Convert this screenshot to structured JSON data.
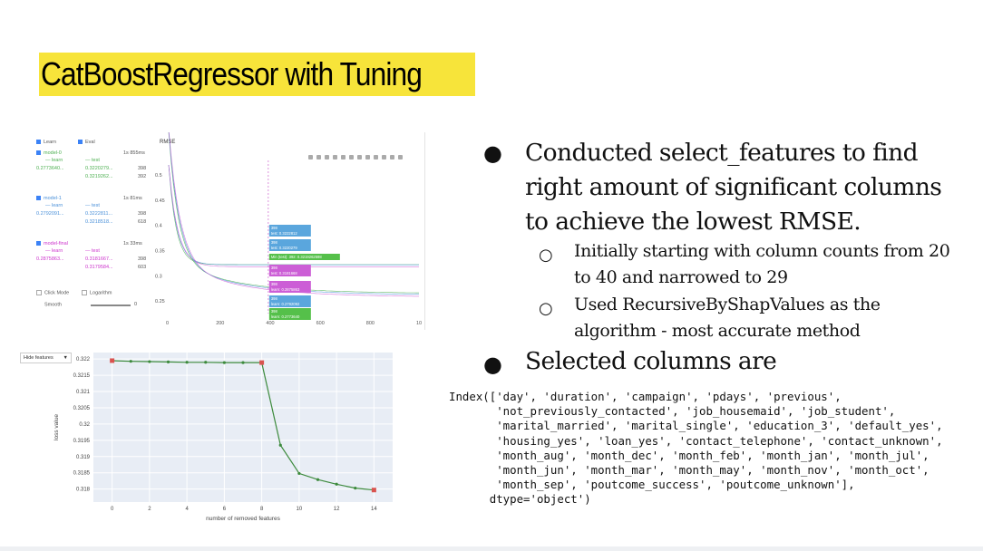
{
  "slide": {
    "title": "CatBoostRegressor with Tuning",
    "bullets": [
      {
        "text": "Conducted select_features to find right amount of significant columns to achieve the lowest RMSE."
      },
      {
        "text": "Initially starting with column counts from 20 to 40 and narrowed to 29"
      },
      {
        "text": "Used RecursiveByShapValues as the algorithm - most accurate method"
      },
      {
        "text": "Selected columns are"
      }
    ],
    "code": "Index(['day', 'duration', 'campaign', 'pdays', 'previous',\n       'not_previously_contacted', 'job_housemaid', 'job_student',\n       'marital_married', 'marital_single', 'education_3', 'default_yes',\n       'housing_yes', 'loan_yes', 'contact_telephone', 'contact_unknown',\n       'month_aug', 'month_dec', 'month_feb', 'month_jan', 'month_jul',\n       'month_jun', 'month_mar', 'month_may', 'month_nov', 'month_oct',\n       'month_sep', 'poutcome_success', 'poutcome_unknown'],\n      dtype='object')"
  },
  "catboost_widget": {
    "legend": {
      "learn": "Learn",
      "eval": "Eval"
    },
    "models": [
      {
        "name": "model-0",
        "time": "1s 855ms",
        "learn_label": "— learn",
        "test_label": "— test",
        "learn_val": "0.2773640...",
        "test_val": "0.3220279...",
        "iter1": "398",
        "test_best": "0.3219262...",
        "iter2": "392",
        "color": "#4caf50"
      },
      {
        "name": "model-1",
        "time": "1s 81ms",
        "learn_label": "— learn",
        "test_label": "— test",
        "learn_val": "0.2792091...",
        "test_val": "0.3222811...",
        "iter1": "398",
        "test_best": "0.3218518...",
        "iter2": "618",
        "color": "#4a90d9"
      },
      {
        "name": "model-final",
        "time": "1s 33ms",
        "learn_label": "— learn",
        "test_label": "— test",
        "learn_val": "0.2875863...",
        "test_val": "0.3181667...",
        "iter1": "398",
        "test_best": "0.3179584...",
        "iter2": "603",
        "color": "#cc33cc"
      }
    ],
    "controls": {
      "click_mode": "Click Mode",
      "logarithm": "Logarithm",
      "smooth": "Smooth",
      "smooth_value": "0"
    },
    "plot": {
      "title": "RMSE",
      "y_ticks": [
        "0.5",
        "0.45",
        "0.4",
        "0.35",
        "0.3",
        "0.25"
      ],
      "x_ticks": [
        "0",
        "200",
        "400",
        "600",
        "800",
        "10"
      ],
      "tooltips": [
        {
          "line1": "398",
          "line2": "test: 0.3222812",
          "color": "#5aa6dd"
        },
        {
          "line1": "398",
          "line2": "test: 0.3220279",
          "color": "#5aa6dd"
        },
        {
          "line1": "Min (test): 392: 0.3219262598",
          "line2": "",
          "color": "#55c04a"
        },
        {
          "line1": "398",
          "line2": "test: 0.3181668",
          "color": "#cc5ed6"
        },
        {
          "line1": "398",
          "line2": "learn: 0.2875863",
          "color": "#cc5ed6"
        },
        {
          "line1": "398",
          "line2": "learn: 0.2792092",
          "color": "#5aa6dd"
        },
        {
          "line1": "398",
          "line2": "learn: 0.2773640",
          "color": "#55c04a"
        }
      ]
    }
  },
  "loss_chart": {
    "dropdown": "Hide features",
    "ylabel": "loss value",
    "xlabel": "number of removed features",
    "y_ticks": [
      "0.322",
      "0.3215",
      "0.321",
      "0.3205",
      "0.32",
      "0.3195",
      "0.319",
      "0.3185",
      "0.318"
    ],
    "x_ticks": [
      "0",
      "2",
      "4",
      "6",
      "8",
      "10",
      "12",
      "14"
    ]
  },
  "chart_data": {
    "type": "line",
    "title": "",
    "xlabel": "number of removed features",
    "ylabel": "loss value",
    "xlim": [
      -1,
      15
    ],
    "ylim": [
      0.3176,
      0.3222
    ],
    "grid": true,
    "series": [
      {
        "x": [
          0,
          1,
          2,
          3,
          4,
          5,
          6,
          7,
          8,
          9,
          10,
          11,
          12,
          13,
          14
        ],
        "values": [
          0.32195,
          0.32193,
          0.32192,
          0.32191,
          0.3219,
          0.3219,
          0.32189,
          0.32189,
          0.32189,
          0.31935,
          0.31848,
          0.31829,
          0.31815,
          0.31803,
          0.31797
        ]
      }
    ],
    "highlighted_points": [
      0,
      8,
      14
    ],
    "line_color": "#3c8a3c",
    "highlight_color": "#d9534f"
  }
}
